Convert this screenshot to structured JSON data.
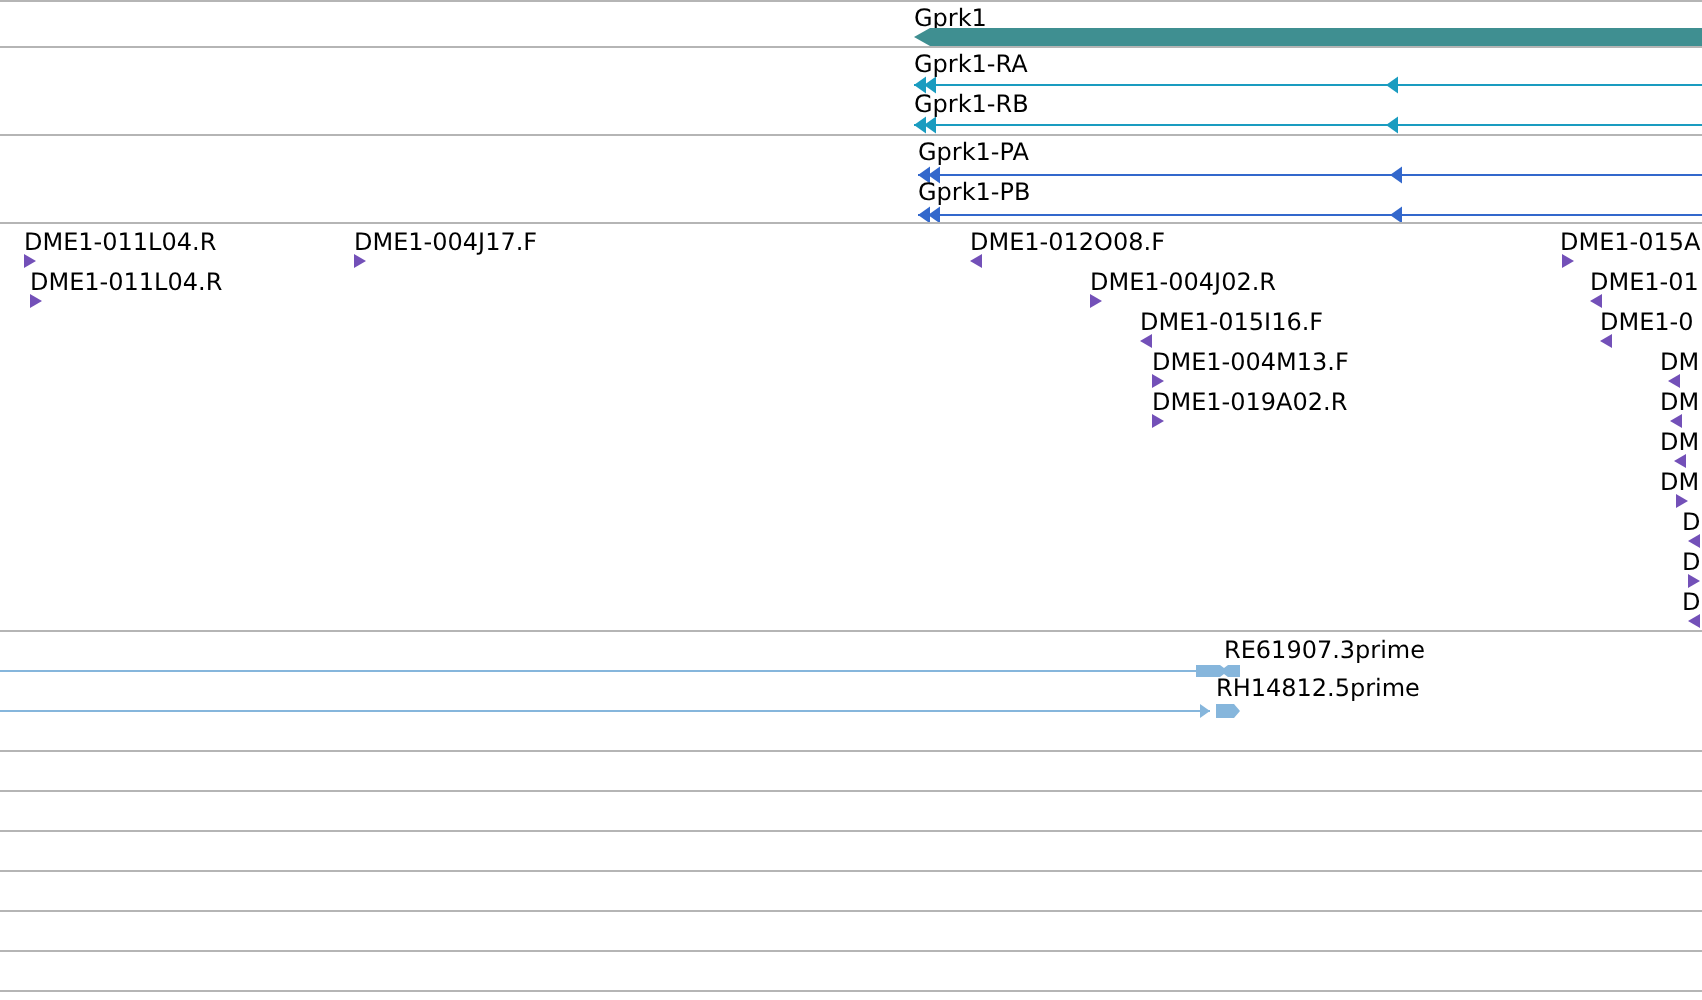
{
  "gene_track": {
    "genes": [
      {
        "name": "Gprk1",
        "reverse": true
      }
    ]
  },
  "transcript_track": {
    "transcripts": [
      {
        "name": "Gprk1-RA",
        "reverse": true
      },
      {
        "name": "Gprk1-RB",
        "reverse": true
      }
    ]
  },
  "protein_track": {
    "proteins": [
      {
        "name": "Gprk1-PA",
        "reverse": true
      },
      {
        "name": "Gprk1-PB",
        "reverse": true
      }
    ]
  },
  "probe_track": {
    "probes": [
      {
        "name": "DME1-011L04.R",
        "reverse": false
      },
      {
        "name": "DME1-011L04.R",
        "reverse": false
      },
      {
        "name": "DME1-004J17.F",
        "reverse": false
      },
      {
        "name": "DME1-012O08.F",
        "reverse": true
      },
      {
        "name": "DME1-004J02.R",
        "reverse": false
      },
      {
        "name": "DME1-015I16.F",
        "reverse": true
      },
      {
        "name": "DME1-004M13.F",
        "reverse": false
      },
      {
        "name": "DME1-019A02.R",
        "reverse": false
      },
      {
        "name": "DME1-015A",
        "reverse": false
      },
      {
        "name": "DME1-01",
        "reverse": true
      },
      {
        "name": "DME1-0",
        "reverse": true
      },
      {
        "name": "DM",
        "reverse": true
      },
      {
        "name": "DM",
        "reverse": true
      },
      {
        "name": "DM",
        "reverse": true
      },
      {
        "name": "DM",
        "reverse": false
      },
      {
        "name": "D",
        "reverse": true
      },
      {
        "name": "D",
        "reverse": false
      },
      {
        "name": "D",
        "reverse": true
      }
    ]
  },
  "est_track": {
    "ests": [
      {
        "name": "RE61907.3prime",
        "reverse": true
      },
      {
        "name": "RH14812.5prime",
        "reverse": false
      }
    ]
  }
}
